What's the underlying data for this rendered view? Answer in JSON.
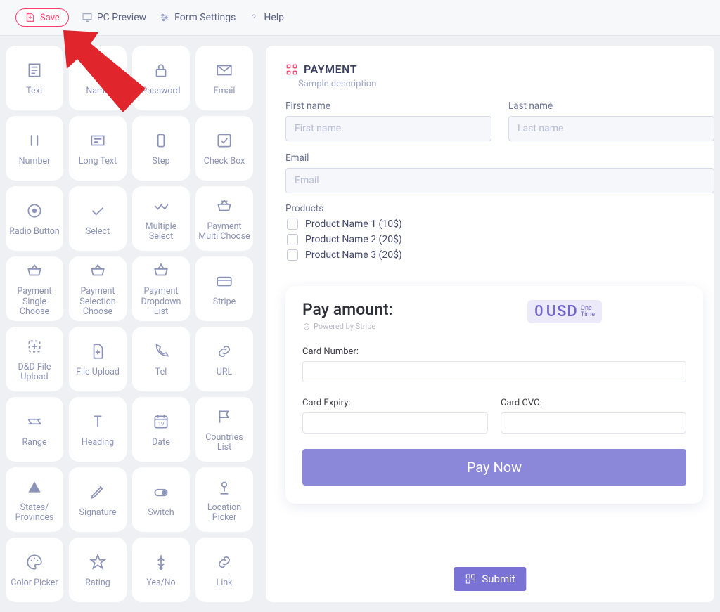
{
  "toolbar": {
    "save": "Save",
    "pc_preview": "PC Preview",
    "form_settings": "Form Settings",
    "help": "Help"
  },
  "palette": [
    {
      "label": "Text",
      "icon": "text"
    },
    {
      "label": "Name",
      "icon": "name"
    },
    {
      "label": "Password",
      "icon": "password"
    },
    {
      "label": "Email",
      "icon": "email"
    },
    {
      "label": "Number",
      "icon": "number"
    },
    {
      "label": "Long Text",
      "icon": "longtext"
    },
    {
      "label": "Step",
      "icon": "step"
    },
    {
      "label": "Check Box",
      "icon": "checkbox"
    },
    {
      "label": "Radio Button",
      "icon": "radio"
    },
    {
      "label": "Select",
      "icon": "select"
    },
    {
      "label": "Multiple Select",
      "icon": "multiselect"
    },
    {
      "label": "Payment Multi Choose",
      "icon": "basketmulti"
    },
    {
      "label": "Payment Single Choose",
      "icon": "basketsingle"
    },
    {
      "label": "Payment Selection Choose",
      "icon": "basketsel"
    },
    {
      "label": "Payment Dropdown List",
      "icon": "basketadd"
    },
    {
      "label": "Stripe",
      "icon": "card"
    },
    {
      "label": "D&D File Upload",
      "icon": "dndupload"
    },
    {
      "label": "File Upload",
      "icon": "fileupload"
    },
    {
      "label": "Tel",
      "icon": "tel"
    },
    {
      "label": "URL",
      "icon": "url"
    },
    {
      "label": "Range",
      "icon": "range"
    },
    {
      "label": "Heading",
      "icon": "heading"
    },
    {
      "label": "Date",
      "icon": "date"
    },
    {
      "label": "Countries List",
      "icon": "flag"
    },
    {
      "label": "States/\nProvinces",
      "icon": "triangle"
    },
    {
      "label": "Signature",
      "icon": "pen"
    },
    {
      "label": "Switch",
      "icon": "switch"
    },
    {
      "label": "Location Picker",
      "icon": "location"
    },
    {
      "label": "Color Picker",
      "icon": "color"
    },
    {
      "label": "Rating",
      "icon": "star"
    },
    {
      "label": "Yes/No",
      "icon": "yesno"
    },
    {
      "label": "Link",
      "icon": "link"
    }
  ],
  "form": {
    "section_title": "PAYMENT",
    "section_desc": "Sample description",
    "first_name_label": "First name",
    "first_name_placeholder": "First name",
    "last_name_label": "Last name",
    "last_name_placeholder": "Last name",
    "email_label": "Email",
    "email_placeholder": "Email",
    "products_label": "Products",
    "products": [
      "Product Name 1 (10$)",
      "Product Name 2 (20$)",
      "Product Name 3 (20$)"
    ]
  },
  "payment": {
    "amount_label": "Pay amount:",
    "powered_by": "Powered by Stripe",
    "amount_value": "0",
    "amount_currency": "USD",
    "amount_period_line1": "One",
    "amount_period_line2": "Time",
    "card_number_label": "Card Number:",
    "card_expiry_label": "Card Expiry:",
    "card_cvc_label": "Card CVC:",
    "pay_now": "Pay Now"
  },
  "submit_label": "Submit"
}
